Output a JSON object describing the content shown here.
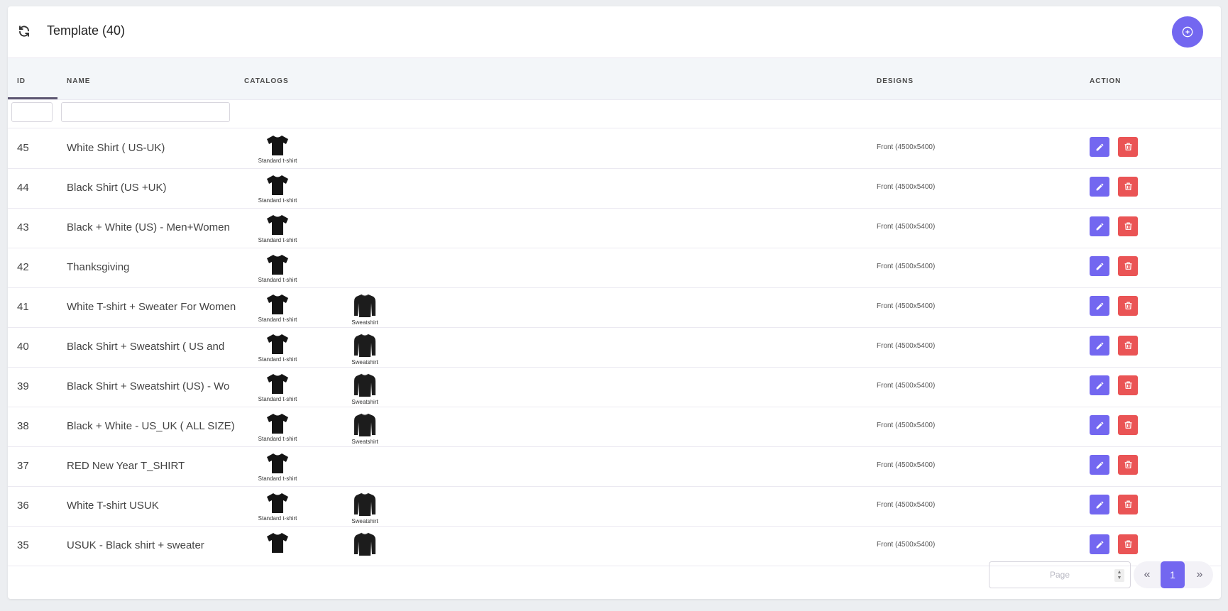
{
  "header": {
    "title": "Template (40)",
    "refresh_icon": "refresh-icon",
    "add_icon": "plus-circle-icon",
    "accent": "#7367f0"
  },
  "columns": {
    "id": "ID",
    "name": "NAME",
    "catalogs": "CATALOGS",
    "designs": "DESIGNS",
    "action": "ACTION"
  },
  "filters": {
    "id_value": "",
    "name_value": ""
  },
  "rows": [
    {
      "id": "45",
      "name": "White Shirt ( US-UK)",
      "catalogs": [
        "Standard t-shirt"
      ],
      "design": "Front (4500x5400)"
    },
    {
      "id": "44",
      "name": "Black Shirt (US +UK)",
      "catalogs": [
        "Standard t-shirt"
      ],
      "design": "Front (4500x5400)"
    },
    {
      "id": "43",
      "name": "Black + White (US) - Men+Women",
      "catalogs": [
        "Standard t-shirt"
      ],
      "design": "Front (4500x5400)"
    },
    {
      "id": "42",
      "name": "Thanksgiving",
      "catalogs": [
        "Standard t-shirt"
      ],
      "design": "Front (4500x5400)"
    },
    {
      "id": "41",
      "name": "White T-shirt + Sweater For Women",
      "catalogs": [
        "Standard t-shirt",
        "Sweatshirt"
      ],
      "design": "Front (4500x5400)"
    },
    {
      "id": "40",
      "name": "Black Shirt + Sweatshirt ( US and",
      "catalogs": [
        "Standard t-shirt",
        "Sweatshirt"
      ],
      "design": "Front (4500x5400)"
    },
    {
      "id": "39",
      "name": "Black Shirt + Sweatshirt (US) - Wo",
      "catalogs": [
        "Standard t-shirt",
        "Sweatshirt"
      ],
      "design": "Front (4500x5400)"
    },
    {
      "id": "38",
      "name": "Black + White - US_UK ( ALL SIZE)",
      "catalogs": [
        "Standard t-shirt",
        "Sweatshirt"
      ],
      "design": "Front (4500x5400)"
    },
    {
      "id": "37",
      "name": "RED New Year T_SHIRT",
      "catalogs": [
        "Standard t-shirt"
      ],
      "design": "Front (4500x5400)"
    },
    {
      "id": "36",
      "name": "White T-shirt USUK",
      "catalogs": [
        "Standard t-shirt",
        "Sweatshirt"
      ],
      "design": "Front (4500x5400)"
    },
    {
      "id": "35",
      "name": "USUK - Black shirt + sweater",
      "catalogs": [
        "Standard t-shirt",
        "Sweatshirt"
      ],
      "design": "Front (4500x5400)"
    }
  ],
  "pagination": {
    "page_placeholder": "Page",
    "current_page": "1",
    "prev_label": "«",
    "next_label": "»"
  },
  "colors": {
    "edit": "#7367f0",
    "delete": "#ea5455"
  }
}
